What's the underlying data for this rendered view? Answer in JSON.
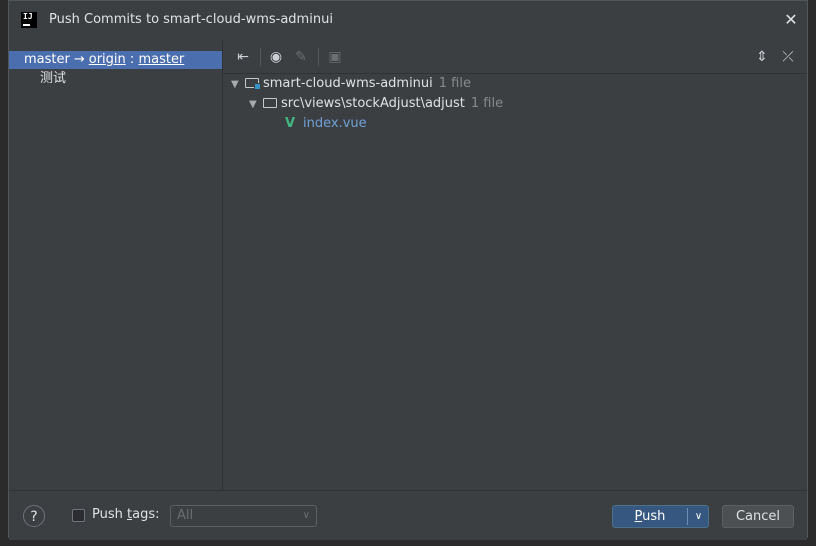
{
  "dialog": {
    "title": "Push Commits to smart-cloud-wms-adminui",
    "app_icon_text": "IJ"
  },
  "left": {
    "branch": {
      "local": "master",
      "arrow": "→",
      "remote": "origin",
      "sep": ":",
      "remote_branch": "master"
    },
    "commits": [
      "测试"
    ]
  },
  "toolbar": {
    "icons": [
      "expand-merge-icon",
      "eye-icon",
      "edit-icon",
      "shelf-icon",
      "expand-all-icon",
      "collapse-all-icon"
    ]
  },
  "tree": {
    "root": {
      "name": "smart-cloud-wms-adminui",
      "count": "1 file"
    },
    "folder": {
      "name": "src\\views\\stockAdjust\\adjust",
      "count": "1 file"
    },
    "file": {
      "name": "index.vue"
    }
  },
  "footer": {
    "help": "?",
    "push_tags_label_pre": "Push ",
    "push_tags_label_u": "t",
    "push_tags_label_post": "ags:",
    "tags_value": "All",
    "push_u": "P",
    "push_rest": "ush",
    "cancel": "Cancel"
  }
}
